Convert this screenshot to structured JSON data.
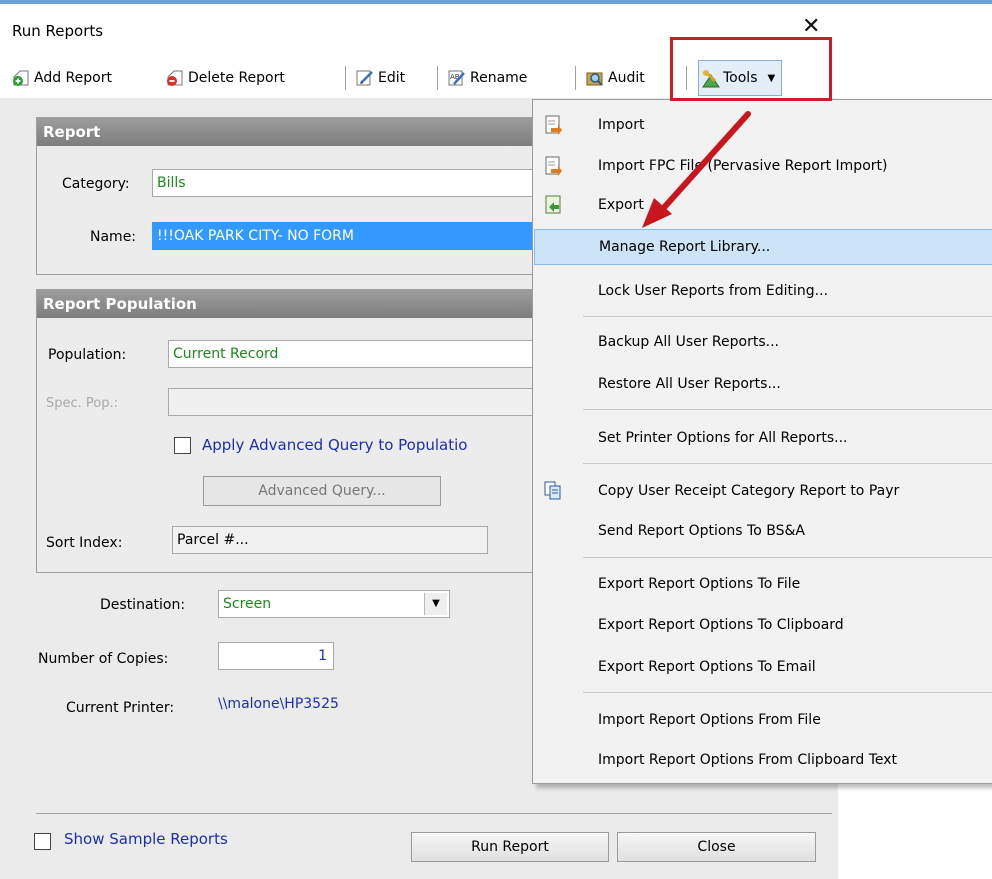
{
  "window": {
    "title": "Run Reports",
    "close_glyph": "✕"
  },
  "toolbar": {
    "add_report": "Add Report",
    "delete_report": "Delete Report",
    "edit": "Edit",
    "rename": "Rename",
    "audit": "Audit",
    "tools": "Tools"
  },
  "report": {
    "header": "Report",
    "category_label": "Category:",
    "category_value": "Bills",
    "name_label": "Name:",
    "name_value": "!!!OAK PARK CITY- NO FORM"
  },
  "population": {
    "header": "Report Population",
    "population_label": "Population:",
    "population_value": "Current Record",
    "spec_pop_label": "Spec. Pop.:",
    "apply_advanced_label": "Apply Advanced Query to Populatio",
    "advanced_query_button": "Advanced Query...",
    "sort_index_label": "Sort Index:",
    "sort_index_value": "Parcel #..."
  },
  "destination": {
    "label": "Destination:",
    "value": "Screen",
    "copies_label": "Number of Copies:",
    "copies_value": "1",
    "printer_label": "Current Printer:",
    "printer_value": "\\\\malone\\HP3525"
  },
  "footer": {
    "show_sample_label": "Show Sample Reports",
    "run_report": "Run Report",
    "close": "Close"
  },
  "tools_menu": {
    "items": [
      {
        "label": "Import"
      },
      {
        "label": "Import FPC File (Pervasive Report Import)"
      },
      {
        "label": "Export"
      },
      {
        "label": "Manage Report Library..."
      },
      {
        "label": "Lock User Reports from Editing..."
      },
      {
        "label": "Backup All User Reports..."
      },
      {
        "label": "Restore All User Reports..."
      },
      {
        "label": "Set Printer Options for All Reports..."
      },
      {
        "label": "Copy User Receipt Category Report to Payr"
      },
      {
        "label": "Send Report Options To BS&A"
      },
      {
        "label": "Export Report Options To File"
      },
      {
        "label": "Export Report Options To Clipboard"
      },
      {
        "label": "Export Report Options To Email"
      },
      {
        "label": "Import Report Options From File"
      },
      {
        "label": "Import Report Options From Clipboard Text"
      }
    ]
  },
  "colors": {
    "highlight_box": "#cf1b25",
    "arrow": "#c8161e",
    "menu_highlight": "#cce4f7"
  }
}
